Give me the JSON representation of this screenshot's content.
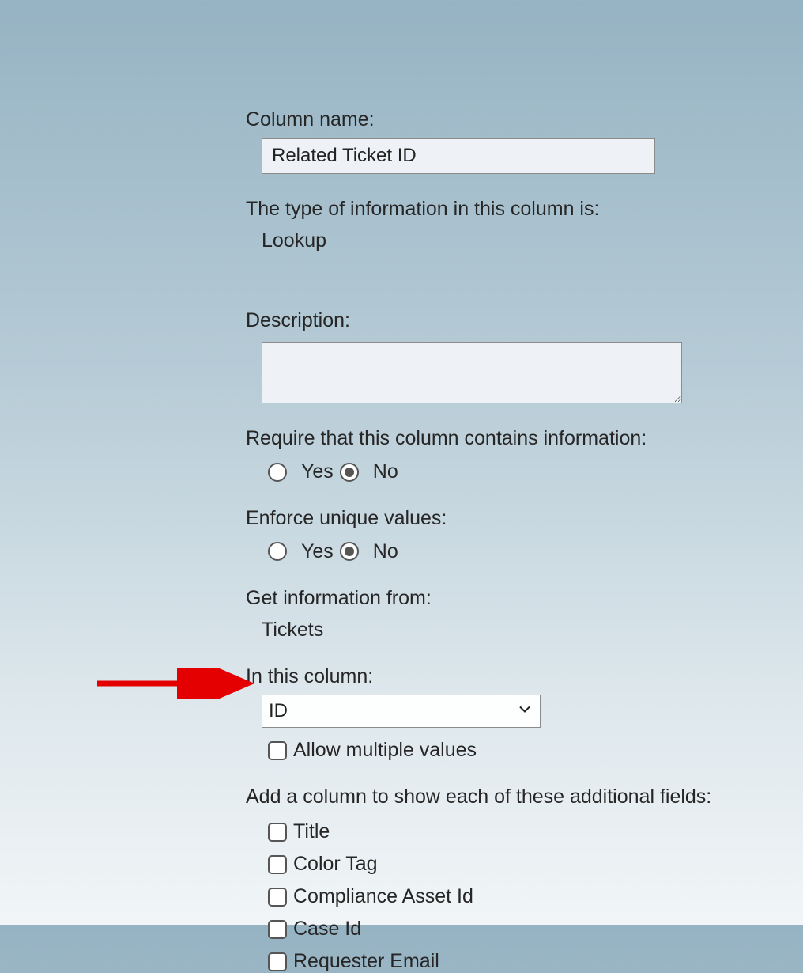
{
  "labels": {
    "column_name": "Column name:",
    "type_info": "The type of information in this column is:",
    "description": "Description:",
    "require": "Require that this column contains information:",
    "enforce_unique": "Enforce unique values:",
    "get_info_from": "Get information from:",
    "in_this_column": "In this column:",
    "allow_multiple": "Allow multiple values",
    "add_column": "Add a column to show each of these additional fields:"
  },
  "values": {
    "column_name": "Related Ticket ID",
    "type_value": "Lookup",
    "description": "",
    "get_info_from_value": "Tickets",
    "in_this_column_value": "ID"
  },
  "radios": {
    "yes": "Yes",
    "no": "No",
    "require_selected": "No",
    "unique_selected": "No"
  },
  "additional_fields": [
    "Title",
    "Color Tag",
    "Compliance Asset Id",
    "Case Id",
    "Requester Email"
  ]
}
